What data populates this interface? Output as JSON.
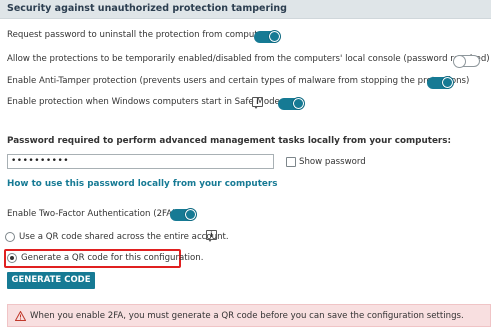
{
  "header": {
    "title": "Security against unauthorized protection tampering"
  },
  "options": [
    {
      "label": "Request password to uninstall the protection from computers",
      "enabled": true
    },
    {
      "label": "Allow the protections to be temporarily enabled/disabled from the computers' local console (password required)",
      "enabled": false
    },
    {
      "label": "Enable Anti-Tamper protection (prevents users and certain types of malware from stopping the protections)",
      "enabled": true
    },
    {
      "label": "Enable protection when Windows computers start in Safe Mode",
      "enabled": true
    }
  ],
  "password": {
    "label": "Password required to perform advanced management tasks locally from your computers:",
    "value": "••••••••••",
    "show_label": "Show password",
    "show_checked": false
  },
  "how_to_link": "How to use this password locally from your computers",
  "two_factor": {
    "label": "Enable Two-Factor Authentication (2FA)",
    "enabled": true,
    "radio_shared": "Use a QR code shared across the entire account.",
    "radio_config": "Generate a QR code for this configuration.",
    "selected": "config"
  },
  "generate_button": "GENERATE CODE",
  "warning": {
    "text": "When you enable 2FA, you must generate a QR code before you can save the configuration settings."
  },
  "icons": {
    "info": "info-icon",
    "warning": "warning-icon"
  },
  "colors": {
    "accent": "#167a94",
    "header_bg": "#dfe5e8",
    "warning_bg": "#f8dfe0",
    "highlight": "#e02020"
  }
}
